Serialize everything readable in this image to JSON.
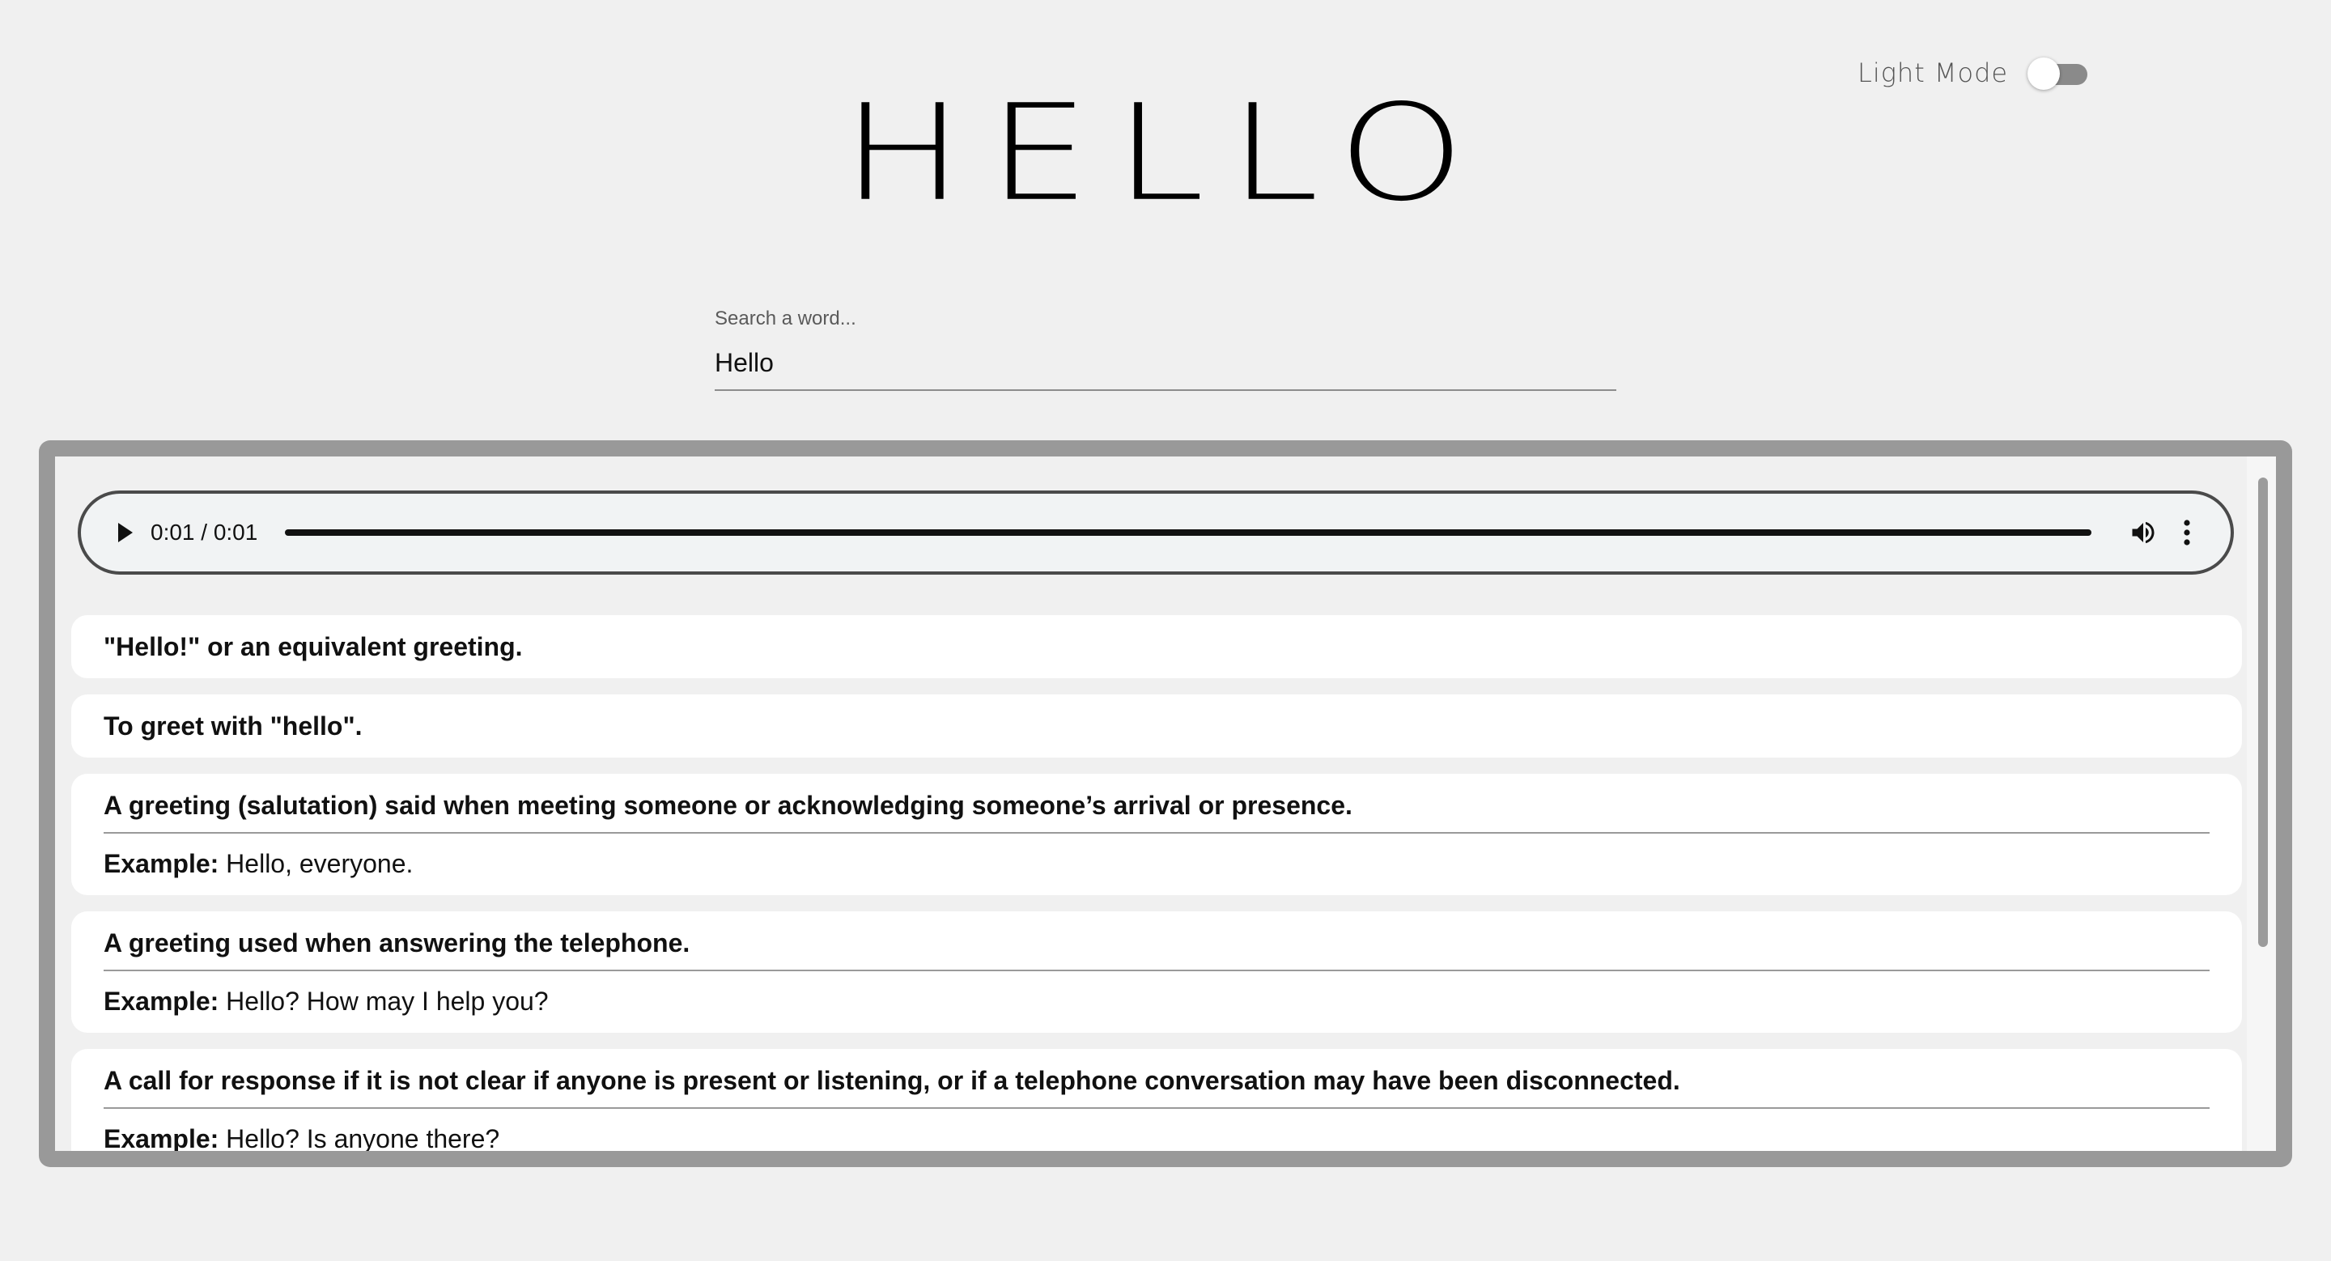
{
  "theme_toggle": {
    "label": "Light Mode",
    "checked": false
  },
  "hero": {
    "title": "HELLO"
  },
  "search": {
    "label": "Search a word...",
    "value": "Hello"
  },
  "audio": {
    "time": "0:01 / 0:01",
    "progress": 1.0,
    "icons": {
      "play": "play-icon",
      "volume": "volume-icon",
      "more": "more-options-icon"
    }
  },
  "example_label": "Example:",
  "definitions": [
    {
      "text": "\"Hello!\" or an equivalent greeting.",
      "example": ""
    },
    {
      "text": "To greet with \"hello\".",
      "example": ""
    },
    {
      "text": "A greeting (salutation) said when meeting someone or acknowledging someone’s arrival or presence.",
      "example": "Hello, everyone."
    },
    {
      "text": "A greeting used when answering the telephone.",
      "example": "Hello? How may I help you?"
    },
    {
      "text": "A call for response if it is not clear if anyone is present or listening, or if a telephone conversation may have been disconnected.",
      "example": "Hello? Is anyone there?"
    }
  ],
  "colors": {
    "background": "#f0f0f0",
    "frame": "#999999",
    "card": "#ffffff",
    "toggle_track": "#8a8a8a"
  }
}
